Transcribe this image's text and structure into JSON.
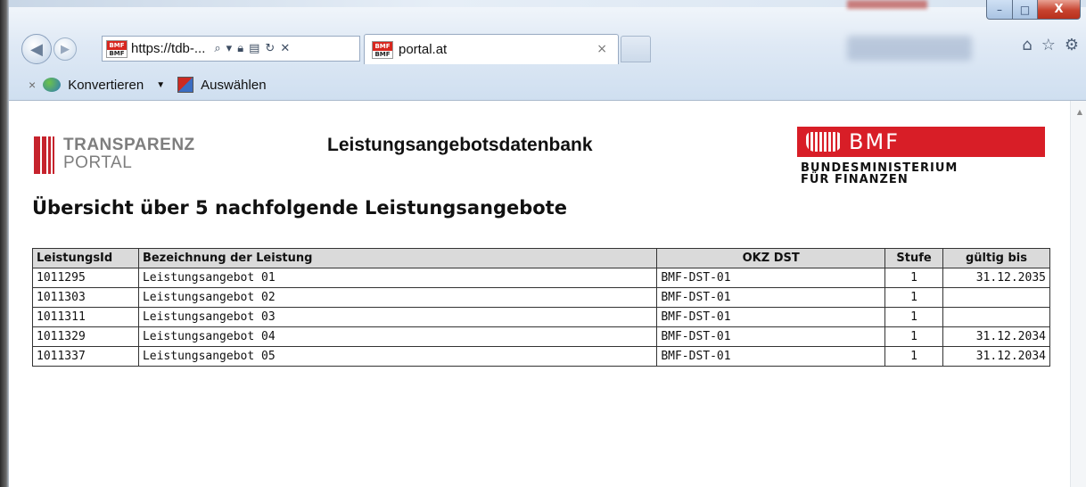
{
  "browser": {
    "address_url": "https://tdb-...",
    "tab_title": "portal.at",
    "tab_close": "×",
    "favicon_top": "BMF",
    "favicon_bottom": "BMF",
    "window_controls": {
      "minimize": "–",
      "maximize": "□",
      "close": "X"
    },
    "icons": [
      "back-icon",
      "forward-icon",
      "search-icon",
      "lock-icon",
      "compat-icon",
      "refresh-icon",
      "stop-icon",
      "home-icon",
      "star-icon",
      "gear-icon"
    ]
  },
  "commandbar": {
    "close_label": "×",
    "convert_label": "Konvertieren",
    "select_label": "Auswählen"
  },
  "page": {
    "logo_line1": "TRANSPARENZ",
    "logo_line2": "PORTAL",
    "title": "Leistungsangebotsdatenbank",
    "bmf_abbr": "BMF",
    "bmf_sub1": "BUNDESMINISTERIUM",
    "bmf_sub2": "FÜR FINANZEN",
    "overview": "Übersicht über 5 nachfolgende Leistungsangebote",
    "accent_red": "#d81e27"
  },
  "table": {
    "headers": {
      "id": "LeistungsId",
      "name": "Bezeichnung der Leistung",
      "okz": "OKZ DST",
      "stufe": "Stufe",
      "valid": "gültig bis"
    },
    "rows": [
      {
        "id": "1011295",
        "name": "Leistungsangebot 01",
        "okz": "BMF-DST-01",
        "stufe": "1",
        "valid": "31.12.2035"
      },
      {
        "id": "1011303",
        "name": "Leistungsangebot 02",
        "okz": "BMF-DST-01",
        "stufe": "1",
        "valid": ""
      },
      {
        "id": "1011311",
        "name": "Leistungsangebot 03",
        "okz": "BMF-DST-01",
        "stufe": "1",
        "valid": ""
      },
      {
        "id": "1011329",
        "name": "Leistungsangebot 04",
        "okz": "BMF-DST-01",
        "stufe": "1",
        "valid": "31.12.2034"
      },
      {
        "id": "1011337",
        "name": "Leistungsangebot 05",
        "okz": "BMF-DST-01",
        "stufe": "1",
        "valid": "31.12.2034"
      }
    ]
  }
}
